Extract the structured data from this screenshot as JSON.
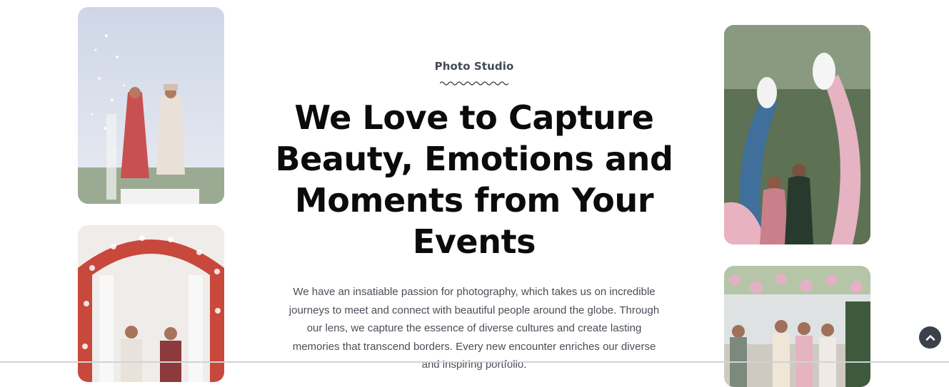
{
  "hero": {
    "eyebrow": "Photo Studio",
    "headline": "We Love to Capture Beauty, Emotions and Moments from Your Events",
    "description": "We have an insatiable passion for photography, which takes us on incredible journeys to meet and connect with beautiful people around the globe. Through our lens, we capture the essence of diverse cultures and create lasting memories that transcend borders. Every new encounter enriches our diverse and inspiring portfolio."
  },
  "icons": {
    "scroll_top": "chevron-up-icon"
  },
  "colors": {
    "heading": "#0b0b0b",
    "body_text": "#4a4e57",
    "scroll_button": "#3a414a"
  }
}
